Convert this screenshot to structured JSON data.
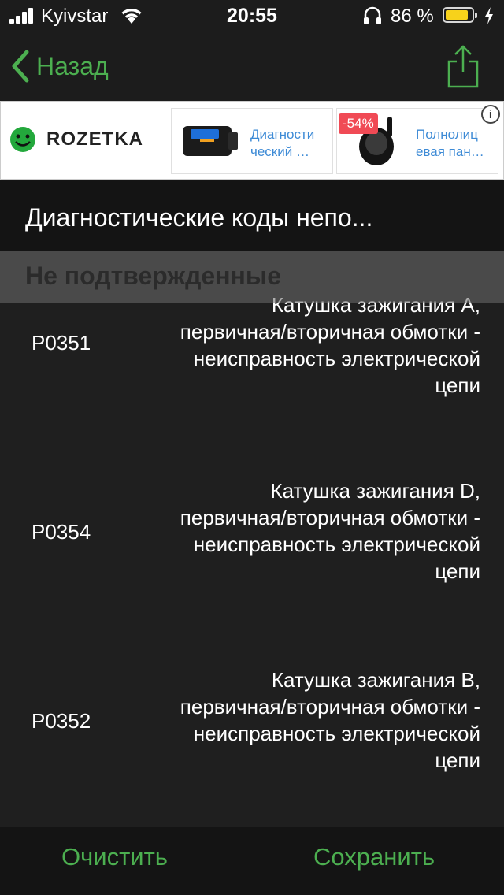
{
  "status_bar": {
    "carrier": "Kyivstar",
    "time": "20:55",
    "battery_percent": "86 %",
    "battery_level": 0.86,
    "battery_color": "#f7d21b"
  },
  "nav": {
    "back_label": "Назад",
    "accent_color": "#4caf50"
  },
  "ad": {
    "logo_text": "ROZETKA",
    "items": [
      {
        "text": "Диагности ческий …"
      },
      {
        "badge": "-54%",
        "text": "Полнолиц евая пан…"
      }
    ],
    "info_label": "i"
  },
  "page": {
    "title": "Диагностические коды непо..."
  },
  "section": {
    "label": "Не подтвержденные"
  },
  "codes": [
    {
      "code": "P0351",
      "lines": [
        "Катушка зажигания A,",
        "первичная/вторичная обмотки -",
        "неисправность электрической",
        "цепи"
      ]
    },
    {
      "code": "P0354",
      "lines": [
        "Катушка зажигания D,",
        "первичная/вторичная обмотки -",
        "неисправность электрической",
        "цепи"
      ]
    },
    {
      "code": "P0352",
      "lines": [
        "Катушка зажигания B,",
        "первичная/вторичная обмотки -",
        "неисправность электрической",
        "цепи"
      ]
    }
  ],
  "toolbar": {
    "clear_label": "Очистить",
    "save_label": "Сохранить"
  }
}
